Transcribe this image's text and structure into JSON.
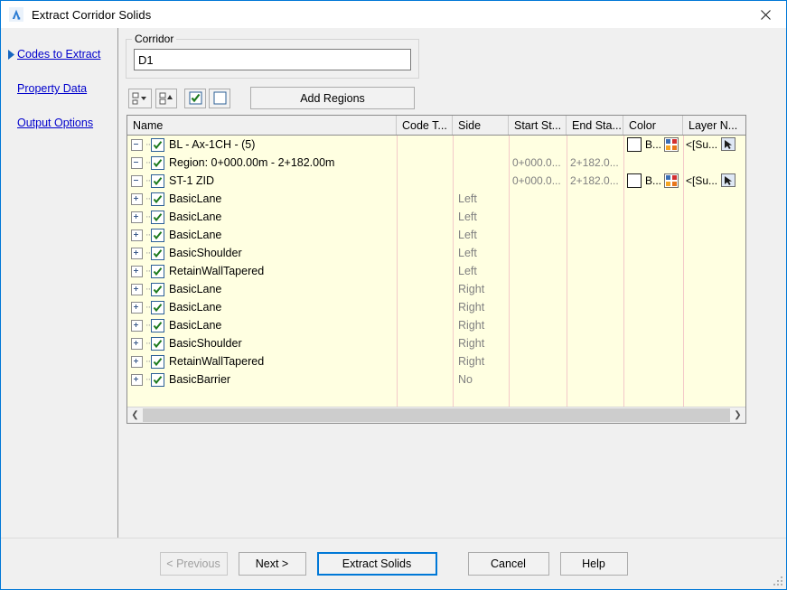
{
  "window": {
    "title": "Extract Corridor Solids",
    "app_icon": "autodesk-a-icon",
    "close_icon": "close-icon"
  },
  "sidebar": {
    "items": [
      {
        "label": "Codes to Extract",
        "selected": true
      },
      {
        "label": "Property Data",
        "selected": false
      },
      {
        "label": "Output Options",
        "selected": false
      }
    ]
  },
  "corridor_group": {
    "legend": "Corridor",
    "value": "D1",
    "placeholder": ""
  },
  "toolbar": {
    "buttons": [
      {
        "name": "expand-tree-dropdown-button",
        "icon": "expand-tree-dropdown-icon"
      },
      {
        "name": "collapse-tree-button",
        "icon": "collapse-tree-icon"
      },
      {
        "name": "check-all-button",
        "icon": "checked-box-icon"
      },
      {
        "name": "uncheck-all-button",
        "icon": "empty-box-icon"
      }
    ],
    "add_regions_label": "Add Regions"
  },
  "grid": {
    "columns": [
      "Name",
      "Code T...",
      "Side",
      "Start St...",
      "End Sta...",
      "Color",
      "Layer N..."
    ],
    "rows": [
      {
        "name": "BL - Ax-1CH - (5)",
        "level": 0,
        "twisty": "minus",
        "checked": true,
        "code": "",
        "side": "",
        "start": "",
        "end": "",
        "color": "B...",
        "layer": "<[Su..."
      },
      {
        "name": "Region: 0+000.00m - 2+182.00m",
        "level": 1,
        "twisty": "minus",
        "checked": true,
        "code": "",
        "side": "",
        "start": "0+000.0...",
        "end": "2+182.0...",
        "color": "",
        "layer": ""
      },
      {
        "name": "ST-1 ZID",
        "level": 2,
        "twisty": "minus",
        "checked": true,
        "code": "",
        "side": "",
        "start": "0+000.0...",
        "end": "2+182.0...",
        "color": "B...",
        "layer": "<[Su..."
      },
      {
        "name": "BasicLane",
        "level": 3,
        "twisty": "plus",
        "checked": true,
        "code": "",
        "side": "Left",
        "start": "",
        "end": "",
        "color": "",
        "layer": ""
      },
      {
        "name": "BasicLane",
        "level": 3,
        "twisty": "plus",
        "checked": true,
        "code": "",
        "side": "Left",
        "start": "",
        "end": "",
        "color": "",
        "layer": ""
      },
      {
        "name": "BasicLane",
        "level": 3,
        "twisty": "plus",
        "checked": true,
        "code": "",
        "side": "Left",
        "start": "",
        "end": "",
        "color": "",
        "layer": ""
      },
      {
        "name": "BasicShoulder",
        "level": 3,
        "twisty": "plus",
        "checked": true,
        "code": "",
        "side": "Left",
        "start": "",
        "end": "",
        "color": "",
        "layer": ""
      },
      {
        "name": "RetainWallTapered",
        "level": 3,
        "twisty": "plus",
        "checked": true,
        "code": "",
        "side": "Left",
        "start": "",
        "end": "",
        "color": "",
        "layer": ""
      },
      {
        "name": "BasicLane",
        "level": 3,
        "twisty": "plus",
        "checked": true,
        "code": "",
        "side": "Right",
        "start": "",
        "end": "",
        "color": "",
        "layer": ""
      },
      {
        "name": "BasicLane",
        "level": 3,
        "twisty": "plus",
        "checked": true,
        "code": "",
        "side": "Right",
        "start": "",
        "end": "",
        "color": "",
        "layer": ""
      },
      {
        "name": "BasicLane",
        "level": 3,
        "twisty": "plus",
        "checked": true,
        "code": "",
        "side": "Right",
        "start": "",
        "end": "",
        "color": "",
        "layer": ""
      },
      {
        "name": "BasicShoulder",
        "level": 3,
        "twisty": "plus",
        "checked": true,
        "code": "",
        "side": "Right",
        "start": "",
        "end": "",
        "color": "",
        "layer": ""
      },
      {
        "name": "RetainWallTapered",
        "level": 3,
        "twisty": "plus",
        "checked": true,
        "code": "",
        "side": "Right",
        "start": "",
        "end": "",
        "color": "",
        "layer": ""
      },
      {
        "name": "BasicBarrier",
        "level": 3,
        "twisty": "plus",
        "checked": true,
        "code": "",
        "side": "No",
        "start": "",
        "end": "",
        "color": "",
        "layer": ""
      }
    ],
    "scrollbar": {
      "left_arrow": "❮",
      "right_arrow": "❯"
    }
  },
  "footer": {
    "previous_label": "< Previous",
    "next_label": "Next >",
    "extract_label": "Extract Solids",
    "cancel_label": "Cancel",
    "help_label": "Help"
  },
  "colors": {
    "accent": "#0078d7",
    "link": "#0000cc",
    "grid_background": "#ffffe1",
    "dialog_background": "#f0f0f0",
    "muted_text": "#808080",
    "grid_line": "#f3c9c9"
  }
}
